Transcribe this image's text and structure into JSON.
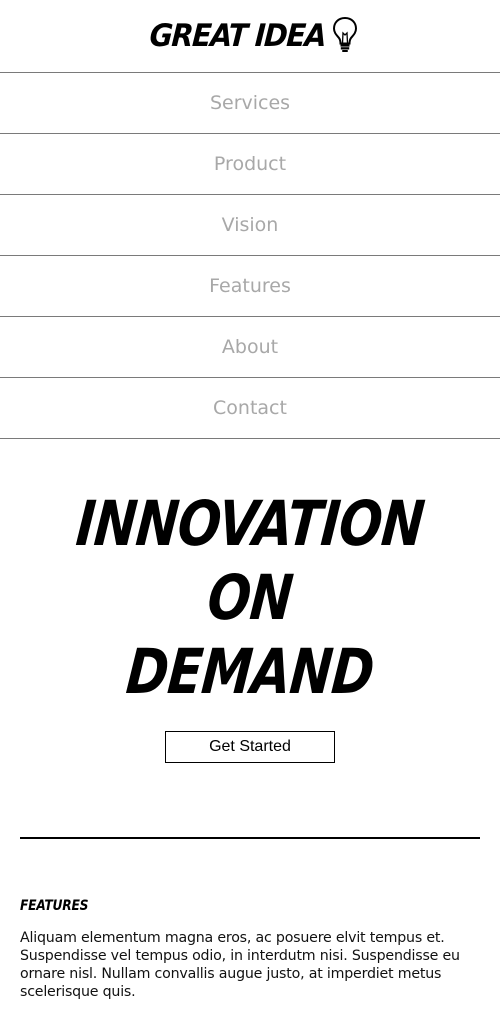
{
  "header": {
    "logo_text": "GREAT IDEA",
    "logo_icon": "lightbulb-icon"
  },
  "nav": {
    "items": [
      {
        "label": "Services"
      },
      {
        "label": "Product"
      },
      {
        "label": "Vision"
      },
      {
        "label": "Features"
      },
      {
        "label": "About"
      },
      {
        "label": "Contact"
      }
    ]
  },
  "hero": {
    "line1": "INNOVATION",
    "line2": "ON",
    "line3": "DEMAND",
    "cta_label": "Get Started"
  },
  "features": {
    "heading": "FEATURES",
    "body": "Aliquam elementum magna eros, ac posuere elvit tempus et. Suspendisse vel tempus odio, in interdutm nisi. Suspendisse eu ornare nisl. Nullam convallis augue justo, at imperdiet metus scelerisque quis."
  },
  "colors": {
    "nav_text": "#a8a8a8",
    "divider": "#7a7a7a",
    "text": "#000000",
    "background": "#ffffff"
  }
}
